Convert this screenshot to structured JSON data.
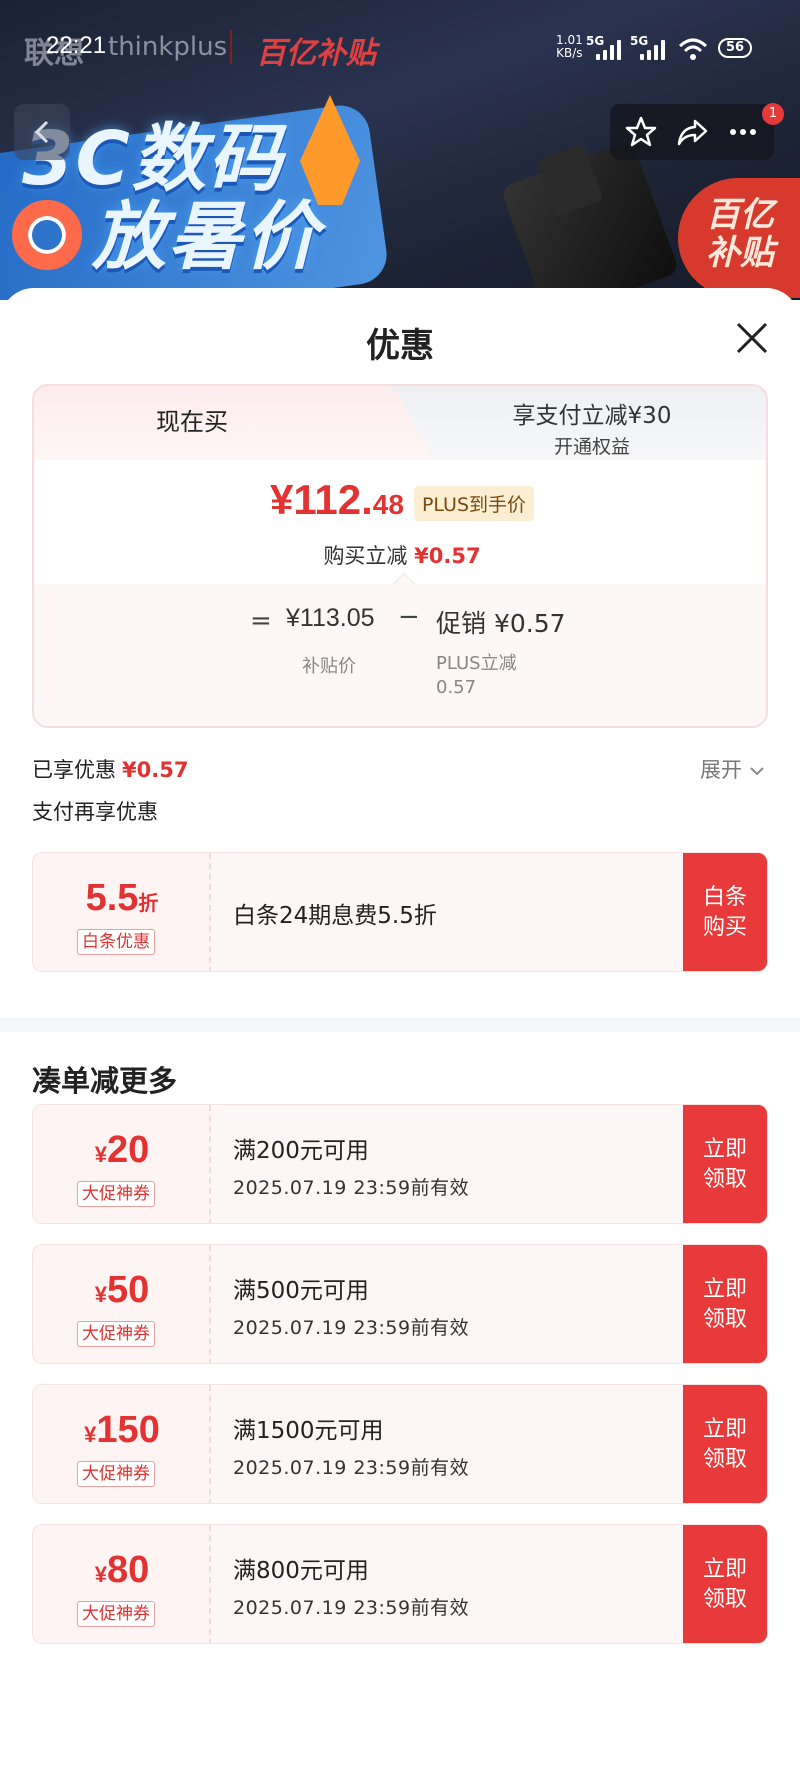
{
  "status_bar": {
    "time": "22:21",
    "net_speed": "1.01\nKB/s",
    "sim1": "5G",
    "sim2": "5G",
    "battery": "56"
  },
  "banner": {
    "brand_cn": "联想",
    "brand_en": "thinkplus",
    "brand_campaign": "百亿补贴",
    "headline_line1": "3C数码",
    "headline_line2": "放暑价",
    "corner_badge": "百亿\n补贴",
    "notification_count": "1"
  },
  "sheet": {
    "title": "优惠",
    "tabs": {
      "active": "现在买",
      "alt_main": "享支付立减¥30",
      "alt_sub": "开通权益"
    },
    "price": {
      "int": "¥112.",
      "dec": "48",
      "tag": "PLUS到手价",
      "reduce_label": "购买立减",
      "reduce_value": "¥0.57"
    },
    "calc": {
      "eq": "=",
      "base": "¥113.05",
      "base_label": "补贴价",
      "minus": "−",
      "promo": "促销 ¥0.57",
      "promo_label": "PLUS立减\n0.57"
    },
    "enjoyed_label": "已享优惠",
    "enjoyed_value": "¥0.57",
    "expand": "展开",
    "pay_more": "支付再享优惠",
    "baitiao": {
      "num": "5.5",
      "unit": "折",
      "tag": "白条优惠",
      "title": "白条24期息费5.5折",
      "btn": "白条\n购买"
    },
    "section_title": "凑单减更多",
    "coupons": [
      {
        "cur": "¥",
        "num": "20",
        "tag": "大促神券",
        "title": "满200元可用",
        "date": "2025.07.19 23:59前有效",
        "btn": "立即\n领取"
      },
      {
        "cur": "¥",
        "num": "50",
        "tag": "大促神券",
        "title": "满500元可用",
        "date": "2025.07.19 23:59前有效",
        "btn": "立即\n领取"
      },
      {
        "cur": "¥",
        "num": "150",
        "tag": "大促神券",
        "title": "满1500元可用",
        "date": "2025.07.19 23:59前有效",
        "btn": "立即\n领取"
      },
      {
        "cur": "¥",
        "num": "80",
        "tag": "大促神券",
        "title": "满800元可用",
        "date": "2025.07.19 23:59前有效",
        "btn": "立即\n领取"
      }
    ]
  },
  "colors": {
    "accent_red": "#e83a3a",
    "price_red": "#e23232",
    "plus_tag_bg": "#fbeed2"
  }
}
